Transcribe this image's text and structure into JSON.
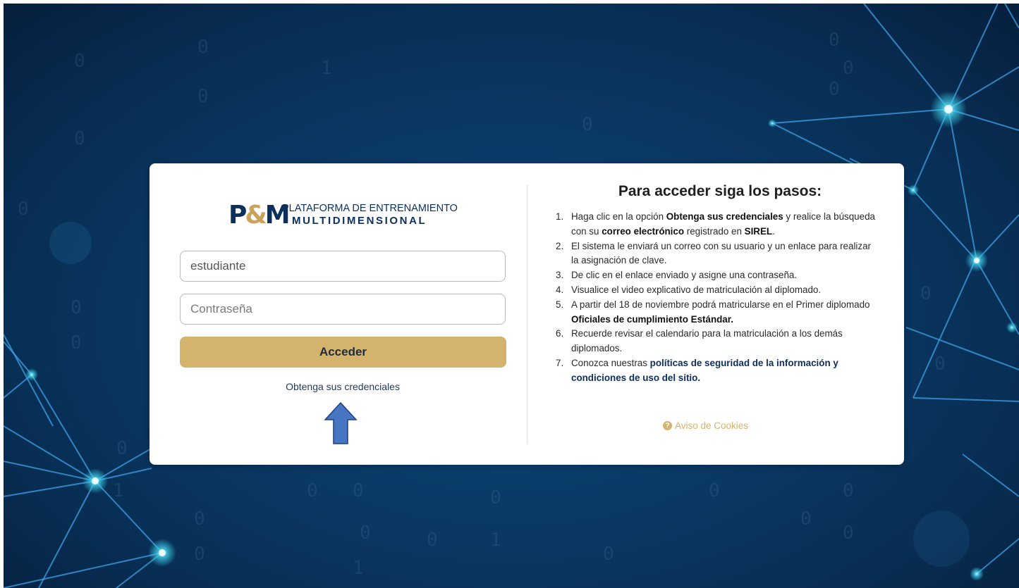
{
  "brand": {
    "logo_mark": "P&M",
    "line1": "PLATAFORMA DE ENTRENAMIENTO",
    "line2": "MULTIDIMENSIONAL"
  },
  "login": {
    "username_value": "estudiante",
    "password_placeholder": "Contraseña",
    "submit_label": "Acceder",
    "credentials_link": "Obtenga sus credenciales",
    "arrow_icon": "arrow-up-icon"
  },
  "steps": {
    "title": "Para acceder siga los pasos:",
    "items": [
      {
        "num": "1.",
        "t1": "Haga clic en la opción ",
        "b1": "Obtenga sus credenciales",
        "t2": " y realice la búsqueda con su ",
        "b2": "correo electrónico",
        "t3": " registrado en ",
        "b3": "SIREL",
        "t4": "."
      },
      {
        "num": "2.",
        "text": "El sistema le enviará un correo con su usuario y un enlace para realizar la asignación de clave."
      },
      {
        "num": "3.",
        "text": "De clic en el enlace enviado y asigne una contraseña."
      },
      {
        "num": "4.",
        "text": "Visualice el video explicativo de matriculación al diplomado."
      },
      {
        "num": "5.",
        "t1": "A partir del 18 de noviembre podrá matricularse en el Primer diplomado ",
        "b1": "Oficiales de cumplimiento Estándar."
      },
      {
        "num": "6.",
        "text": "Recuerde revisar el calendario para la matriculación a los demás diplomados."
      },
      {
        "num": "7.",
        "t1": "Conozca nuestras ",
        "link": "políticas de seguridad de la información y condiciones de uso del sitio."
      }
    ]
  },
  "cookies": {
    "label": "Aviso de Cookies",
    "icon": "question-circle-icon"
  },
  "colors": {
    "background": "#0a3a66",
    "accent": "#d4b46c",
    "navy": "#0d2f5c"
  }
}
